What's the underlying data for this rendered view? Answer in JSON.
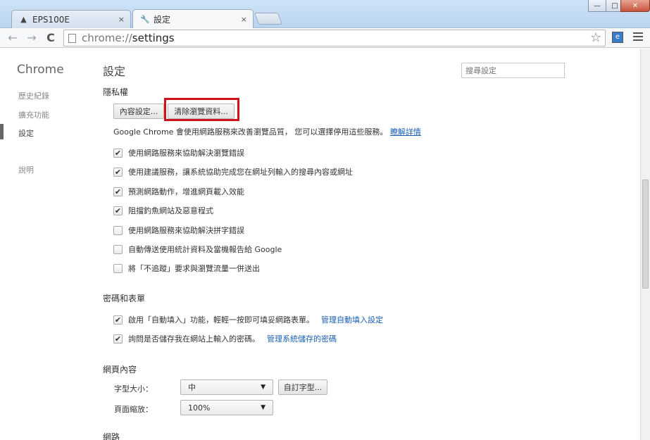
{
  "window": {
    "tabs": [
      {
        "label": "EPS100E",
        "icon": "bell-icon"
      },
      {
        "label": "設定",
        "icon": "wrench-icon"
      }
    ],
    "close_glyph": "×",
    "minimize_glyph": "—",
    "maximize_glyph": "□",
    "close_window_glyph": "✕"
  },
  "toolbar": {
    "back_glyph": "←",
    "forward_glyph": "→",
    "reload_glyph": "C",
    "url_scheme": "chrome://",
    "url_host": "settings",
    "star_glyph": "☆"
  },
  "sidebar": {
    "brand": "Chrome",
    "items": [
      {
        "label": "歷史紀錄"
      },
      {
        "label": "擴充功能"
      },
      {
        "label": "設定"
      },
      {
        "label": "說明"
      }
    ],
    "selected_index": 2
  },
  "header": {
    "title": "設定",
    "search_placeholder": "搜尋設定"
  },
  "privacy": {
    "heading": "隱私權",
    "content_settings_button": "內容設定...",
    "clear_data_button": "清除瀏覽資料...",
    "info_text": "Google Chrome 會使用網路服務來改善瀏覽品質， 您可以選擇停用這些服務。",
    "learn_more_link": "瞭解詳情",
    "options": [
      {
        "label": "使用網路服務來協助解決瀏覽錯誤",
        "checked": true
      },
      {
        "label": "使用建議服務，讓系統協助完成您在網址列輸入的搜尋內容或網址",
        "checked": true
      },
      {
        "label": "預測網路動作，增進網頁載入效能",
        "checked": true
      },
      {
        "label": "阻擋釣魚網站及惡意程式",
        "checked": true
      },
      {
        "label": "使用網路服務來協助解決拼字錯誤",
        "checked": false
      },
      {
        "label": "自動傳送使用統計資料及當機報告給 Google",
        "checked": false
      },
      {
        "label": "將「不追蹤」要求與瀏覽流量一併送出",
        "checked": false
      }
    ],
    "check_glyph": "✔"
  },
  "passwords": {
    "heading": "密碼和表單",
    "autofill_label": "啟用「自動填入」功能，輕輕一按即可填妥網路表單。",
    "autofill_link": "管理自動填入設定",
    "save_pw_label": "詢問是否儲存我在網站上輸入的密碼。",
    "save_pw_link": "管理系統儲存的密碼",
    "autofill_checked": true,
    "save_pw_checked": true
  },
  "web_content": {
    "heading": "網頁內容",
    "font_size_label": "字型大小：",
    "font_size_value": "中",
    "customize_fonts_button": "自訂字型...",
    "zoom_label": "頁面縮放：",
    "zoom_value": "100%",
    "dropdown_glyph": "▼"
  },
  "next_section": {
    "heading": "網路"
  }
}
